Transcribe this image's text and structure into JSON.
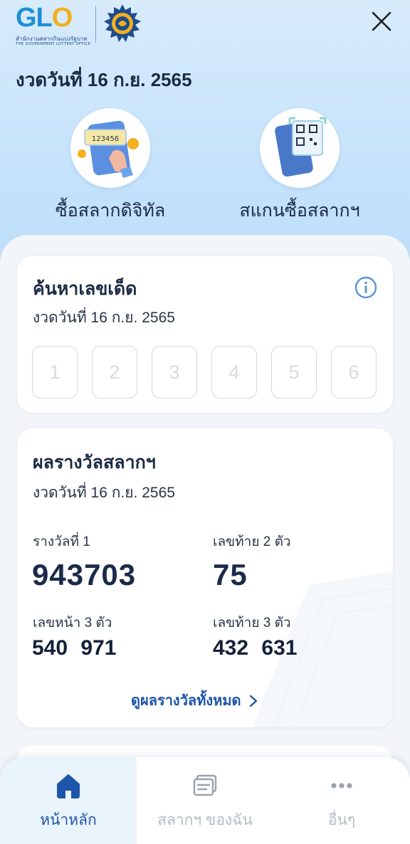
{
  "header": {
    "logo_text_1": "GL",
    "logo_text_2": "O",
    "logo_sub_th": "สำนักงานสลากกินแบ่งรัฐบาล",
    "logo_sub_en": "THE GOVERNMENT LOTTERY OFFICE",
    "draw_date_title": "งวดวันที่ 16 ก.ย. 2565"
  },
  "actions": [
    {
      "label": "ซื้อสลากดิจิทัล",
      "ticket_number": "123456"
    },
    {
      "label": "สแกนซื้อสลากฯ"
    }
  ],
  "search_card": {
    "title": "ค้นหาเลขเด็ด",
    "draw_date": "งวดวันที่  16 ก.ย. 2565",
    "digit_placeholders": [
      "1",
      "2",
      "3",
      "4",
      "5",
      "6"
    ]
  },
  "results_card": {
    "title": "ผลรางวัลสลากฯ",
    "draw_date": "งวดวันที่  16 ก.ย. 2565",
    "first_prize_label": "รางวัลที่ 1",
    "first_prize": "943703",
    "last2_label": "เลขท้าย 2 ตัว",
    "last2": "75",
    "front3_label": "เลขหน้า 3 ตัว",
    "front3": "540  971",
    "last3_label": "เลขท้าย 3 ตัว",
    "last3": "432  631",
    "see_all": "ดูผลรางวัลทั้งหมด"
  },
  "nav": {
    "home": "หน้าหลัก",
    "my_tickets": "สลากฯ ของฉัน",
    "more": "อื่นๆ"
  },
  "colors": {
    "accent": "#1d55a8",
    "title": "#1c2a44",
    "nav_inactive": "#b5bcc6"
  }
}
